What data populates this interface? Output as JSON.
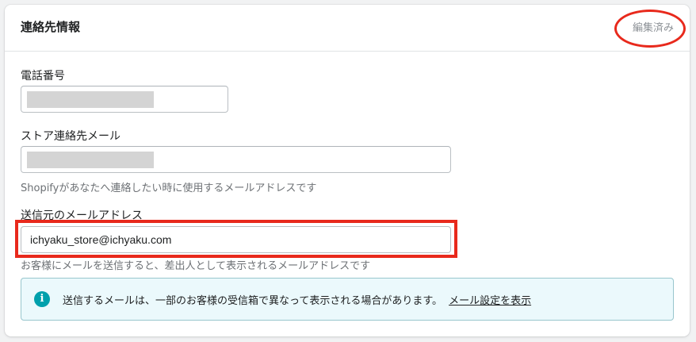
{
  "section": {
    "title": "連絡先情報",
    "status": "編集済み"
  },
  "phone": {
    "label": "電話番号"
  },
  "store_email": {
    "label": "ストア連絡先メール",
    "help": "Shopifyがあなたへ連絡したい時に使用するメールアドレスです"
  },
  "sender_email": {
    "label": "送信元のメールアドレス",
    "value": "ichyaku_store@ichyaku.com",
    "help": "お客様にメールを送信すると、差出人として表示されるメールアドレスです"
  },
  "banner": {
    "icon": "info-icon",
    "text": "送信するメールは、一部のお客様の受信箱で異なって表示される場合があります。",
    "link": "メール設定を表示"
  },
  "colors": {
    "annotation": "#e8291c",
    "banner_background": "#ebf9fc",
    "info_icon": "#00a0ac"
  }
}
